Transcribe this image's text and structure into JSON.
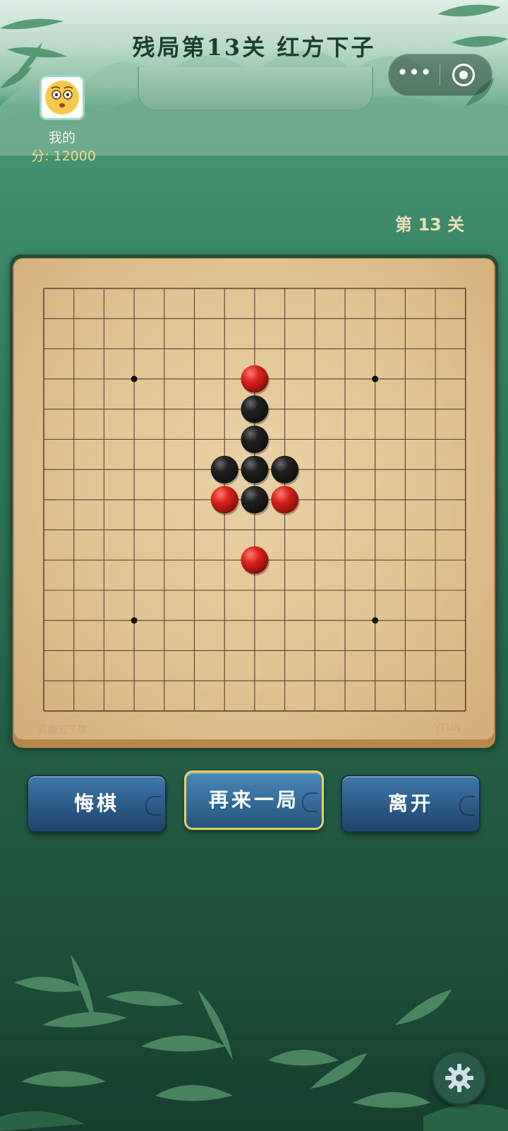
{
  "header": {
    "title": "残局第13关 红方下子",
    "more_icon": "more-dots-icon",
    "close_icon": "target-circle-icon"
  },
  "player": {
    "name": "我的",
    "score": "分: 12000",
    "avatar_icon": "surprised-face-icon"
  },
  "level_label": "第 13 关",
  "board": {
    "size": 15,
    "star_points": [
      [
        3,
        3
      ],
      [
        3,
        11
      ],
      [
        11,
        3
      ],
      [
        11,
        11
      ]
    ],
    "stones": [
      {
        "row": 3,
        "col": 7,
        "color": "red"
      },
      {
        "row": 4,
        "col": 7,
        "color": "black"
      },
      {
        "row": 5,
        "col": 7,
        "color": "black"
      },
      {
        "row": 6,
        "col": 6,
        "color": "black"
      },
      {
        "row": 6,
        "col": 7,
        "color": "black"
      },
      {
        "row": 6,
        "col": 8,
        "color": "black"
      },
      {
        "row": 7,
        "col": 6,
        "color": "red"
      },
      {
        "row": 7,
        "col": 7,
        "color": "black"
      },
      {
        "row": 7,
        "col": 8,
        "color": "red"
      },
      {
        "row": 9,
        "col": 7,
        "color": "red"
      }
    ],
    "label_left": "弈趣五子棋",
    "label_right": "YFUN"
  },
  "buttons": {
    "undo": "悔棋",
    "restart": "再来一局",
    "leave": "离开"
  },
  "settings_icon": "gear-icon",
  "colors": {
    "red_stone": "#d8241c",
    "black_stone": "#111111",
    "button_blue": "#2d5d8b",
    "highlight_gold": "#e8cf62"
  }
}
